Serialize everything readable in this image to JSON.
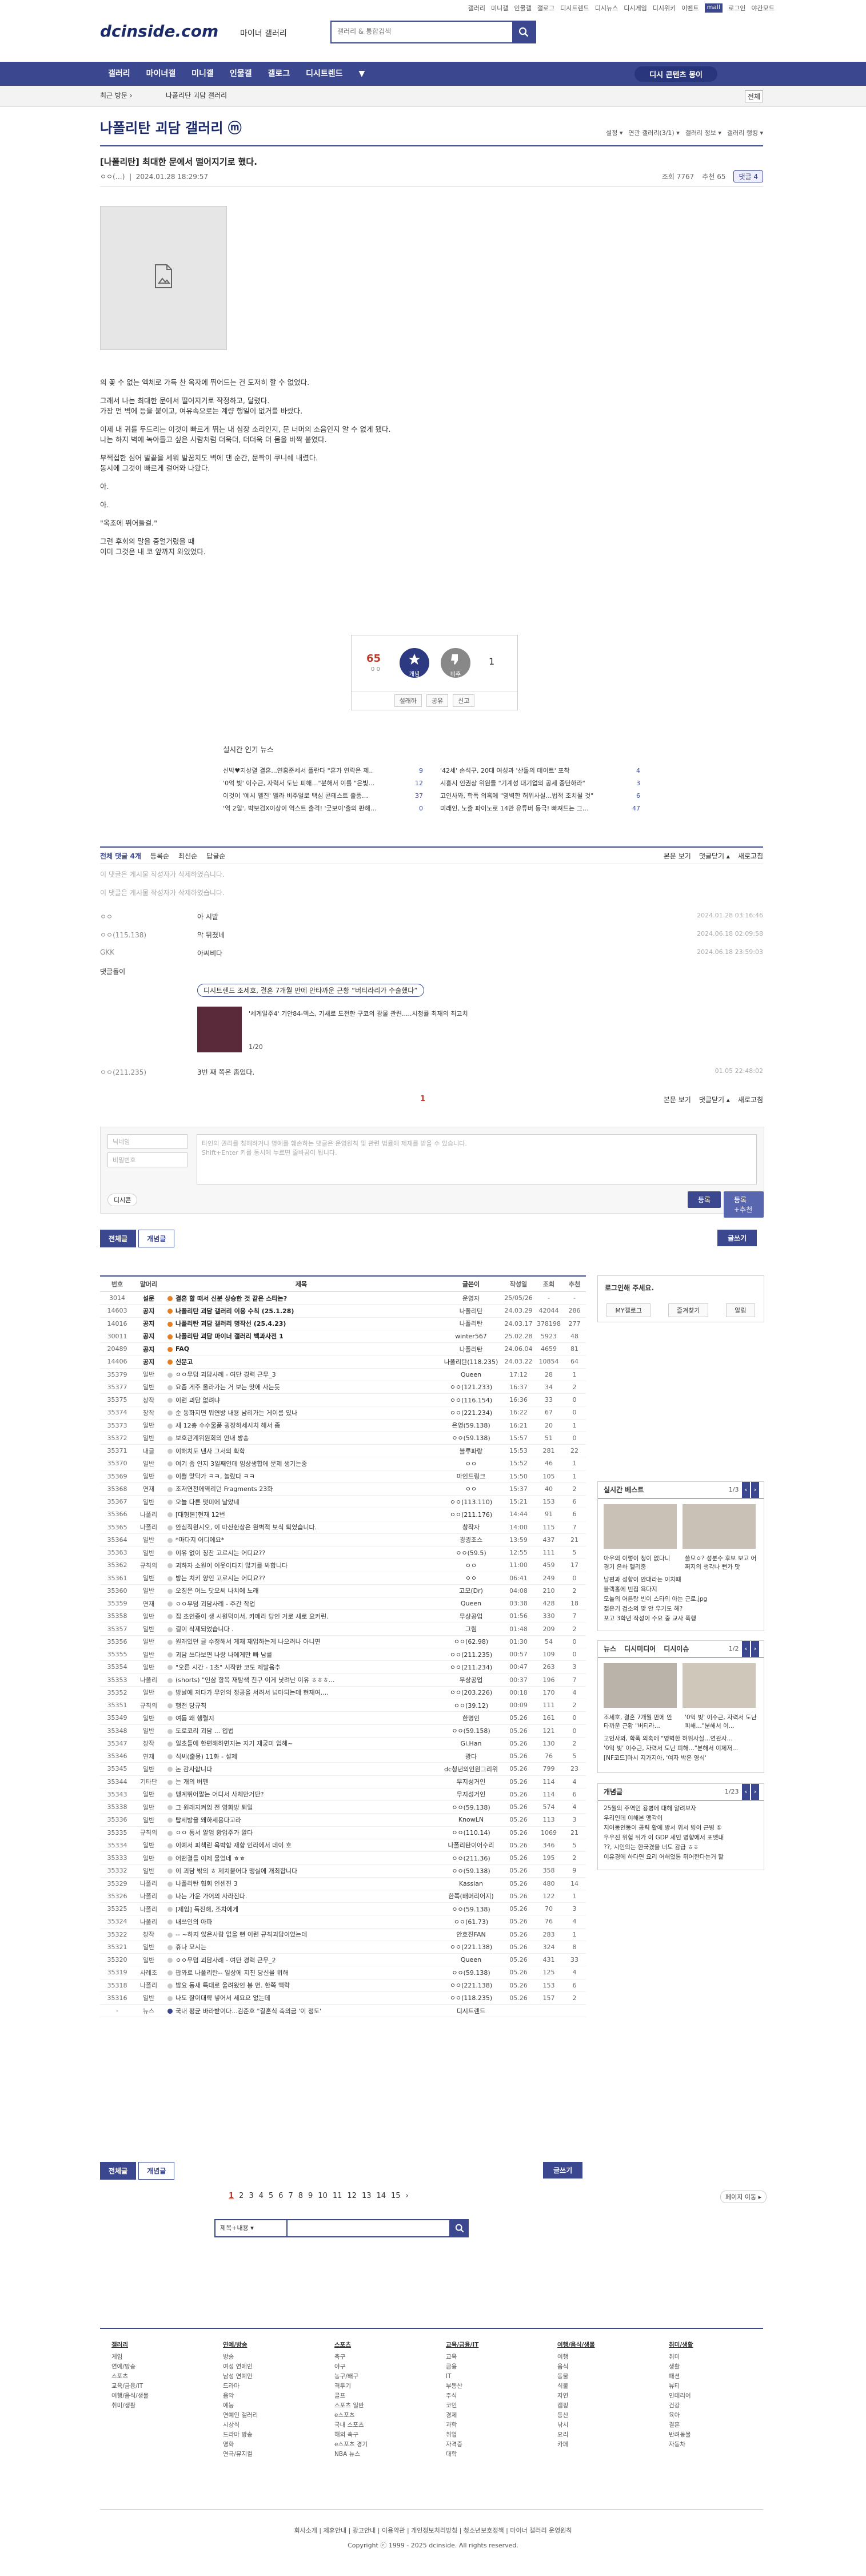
{
  "util": [
    "갤러리",
    "미니갤",
    "인물갤",
    "갤로그",
    "디시트렌드",
    "디시뉴스",
    "디시게임",
    "디시위키",
    "이벤트",
    "mall",
    "로그인",
    "야간모드"
  ],
  "logo": {
    "text": "dcinside.com",
    "sub": "마이너 갤러리"
  },
  "search": {
    "placeholder": "갤러리 & 통합검색"
  },
  "nav": {
    "items": [
      "갤러리",
      "마이너갤",
      "미니갤",
      "인물갤",
      "갤로그",
      "디시트렌드",
      "▼"
    ],
    "right": "디시 콘텐츠 몽이"
  },
  "subnav": {
    "recent": "최근 방문 ›",
    "gallery": "나폴리탄 괴담 갤러리",
    "btn": "전체"
  },
  "gallery": {
    "title": "나폴리탄 괴담 갤러리 ⓜ",
    "tools": [
      "설정 ▾",
      "연관 갤러리(3/1) ▾",
      "갤러리 정보 ▾",
      "갤러리 랭킹 ▾"
    ]
  },
  "post": {
    "title": "[나폴리탄] 최대한 문에서 떨어지기로 했다.",
    "author": "ㅇㅇ(…)",
    "date": "2024.01.28 18:29:57",
    "views": "조회 7767",
    "recs": "추천 65",
    "comments": "댓글 4",
    "body": [
      "의 꽃 수 없는 엑체로 가득 찬 옥자에 뛰어드는 건 도저히 할 수 없었다.",
      "",
      "그래서 나는 최대한 문에서 떨어지기로 작정하고, 달렸다.\n가장 먼 벽에 등을 붙이고, 여유속으로는 계량 행일이 없거를 바랐다.",
      "",
      "이제 내 귀를 두드리는 이것이 빠르게 뛰는 내 심장 소리인지, 문 너머의 소음인지 알 수 없게 됐다.\n나는 하지 벽에 녹아들고 싶은 사람처럼 더욱더, 더더욱 더 몸을 바짝 붙였다.",
      "",
      "부쩍접한 심어 발끝을 세워 발꿈치도 벽에 댄 순간, 문짝이 쿠니쉐 내렸다.\n동시에 그것이 빠르게 걸어와 나왔다.",
      "",
      "아.",
      "",
      "아.",
      "",
      "\"옥조에 뛰어들걸.\"",
      "",
      "그런 후회의 말을 중얼거렸을 때\n이미 그것은 내 코 앞까지 와있었다."
    ]
  },
  "rec": {
    "up": "65",
    "up_sub": "0 0",
    "up_label": "개념",
    "down_label": "비추",
    "down": "1",
    "actions": [
      "설래하",
      "공유",
      "신고"
    ]
  },
  "news": {
    "title": "실시간 인기 뉴스",
    "left": [
      [
        "신박♥지상렬 결혼...연홍준세서 플란다 \"혼가 연락은 제..",
        "9"
      ],
      [
        "'0억 빚' 이수근, 자력서 도난 피해…\"분해서 이를 \"은빛…",
        "12"
      ],
      [
        "이것이 '예시 멜진' 멜라 비주얼로 택심 콘테스트 출품…",
        "37"
      ],
      [
        "'역 2일', 박보검X이상이 역스트 출격! '굿보이'출의 판해…",
        "0"
      ]
    ],
    "right": [
      [
        "'42세' 손석구, 20대 여성과 '산돌의 데이트' 포착",
        "4"
      ],
      [
        "시흥시 인권상 위원들 \"기계성 대기업의 공세 중단하라\"",
        "3"
      ],
      [
        "고인사와, 학폭 의혹에 \"영벽한 허위사실…법적 조치될 것\"",
        "6"
      ],
      [
        "미래인, 노출 파이노로 14만 유튜버 등극! 빠져드는 그…",
        "47"
      ]
    ]
  },
  "comments": {
    "tabs": [
      "전체 댓글 4개",
      "등록순",
      "최신순",
      "답글순"
    ],
    "right": [
      "본문 보기",
      "댓글닫기 ▴",
      "새로고침"
    ],
    "deleted": [
      "이 댓글은 게시물 작성자가 삭제하였습니다.",
      "이 댓글은 게시물 작성자가 삭제하였습니다."
    ],
    "rows": [
      {
        "nick": "ㅇㅇ",
        "txt": "아 시발",
        "date": "2024.01.28 03:16:46"
      },
      {
        "nick": "ㅇㅇ(115.138)",
        "txt": "악 뒤졌네",
        "date": "2024.06.18 02:09:58"
      },
      {
        "nick": "GKK",
        "txt": "아씨비다",
        "date": "2024.06.18 23:59:03"
      }
    ],
    "ad": {
      "label": "댓글돌이",
      "head": "디시트렌드 조세호, 결혼 7개월 만에 안타까운 근황 “버티라리가 수술했다”",
      "sub": "'세계일주4' 기안84-덱스, 기새로 도전한 구코의 광물 관련.....시청률 최재의 최고치",
      "page": "1/20"
    },
    "last": {
      "nick": "ㅇㅇ(211.235)",
      "txt": "3번 째 쪽은 좀있다.",
      "date": "01.05 22:48:02"
    },
    "page": "1"
  },
  "write": {
    "name": "닉네임",
    "pw": "비밀번호",
    "placeholder": "타인의 권리를 침해하거나 명예를 훼손하는 댓글은 운영원칙 및 관련 법률에 제재를 받을 수 있습니다.\nShift+Enter 키를 동시에 누르면 줄바꿈이 됩니다.",
    "dccon": "디시콘",
    "submit": "등록",
    "submit2": "등록+추천"
  },
  "tabs": {
    "all": "전체글",
    "best": "개념글",
    "write": "글쓰기"
  },
  "list": {
    "headers": [
      "번호",
      "말머리",
      "제목",
      "글쓴이",
      "작성일",
      "조회",
      "추천"
    ],
    "rows": [
      [
        "3014",
        "설문",
        "결혼 할 때서 신분 상승한 것 같은 스타는?",
        "운영자",
        "25/05/26",
        "-",
        "-",
        1
      ],
      [
        "14603",
        "공지",
        "나폴리탄 괴담 갤러리 이용 수칙 (25.1.28)",
        "나폴리탄",
        "24.03.29",
        "42044",
        "286",
        1
      ],
      [
        "14016",
        "공지",
        "나폴리탄 괴담 갤러리 명작선 (25.4.23)",
        "나폴리탄",
        "24.03.17",
        "378198",
        "277",
        1
      ],
      [
        "30011",
        "공지",
        "나폴리탄 괴담 마이너 갤러리 백과사전 1",
        "winter567",
        "25.02.28",
        "5923",
        "48",
        1
      ],
      [
        "20489",
        "공지",
        "FAQ",
        "나폴리탄",
        "24.06.04",
        "4659",
        "81",
        1
      ],
      [
        "14406",
        "공지",
        "신문고",
        "나폴리탄(118.235)",
        "24.03.22",
        "10854",
        "64",
        1
      ],
      [
        "35379",
        "일반",
        "ㅇㅇ무덤 괴담사례 - 여단 경력 근무_3",
        "Queen",
        "17:12",
        "28",
        "1",
        0
      ],
      [
        "35377",
        "일반",
        "요즘 게주 올라가는 거 보는 맛에 사는듯",
        "ㅇㅇ(121.233)",
        "16:37",
        "34",
        "2",
        0
      ],
      [
        "35375",
        "창작",
        "이런 괴담 없려냐",
        "ㅇㅇ(116.154)",
        "16:36",
        "33",
        "0",
        0
      ],
      [
        "35374",
        "창작",
        "순 동화지면 뭐연방 내용 남리가는 게이름 있나",
        "ㅇㅇ(221.234)",
        "16:22",
        "67",
        "0",
        0
      ],
      [
        "35373",
        "일반",
        "새 12층 수수물품 굉장하세시치 해서 좀",
        "은영(59.138)",
        "16:21",
        "20",
        "1",
        0
      ],
      [
        "35372",
        "일반",
        "보호관계위원회의 안내 방송",
        "ㅇㅇ(59.138)",
        "15:57",
        "51",
        "0",
        0
      ],
      [
        "35371",
        "내글",
        "이해치도 낸사 그서의 확학",
        "블루파랑",
        "15:53",
        "281",
        "22",
        0
      ],
      [
        "35370",
        "일반",
        "여기 좀 인지 3일째인데 임상생합에 문제 생기는중",
        "ㅇㅇ",
        "15:52",
        "46",
        "1",
        0
      ],
      [
        "35369",
        "일반",
        "이쁠 맞닥가 ㅋㅋ, 놀랐다 ㅋㅋ",
        "마인드링크",
        "15:50",
        "105",
        "1",
        0
      ],
      [
        "35368",
        "연재",
        "조저연천에역리던 Fragments 23화",
        "ㅇㅇ",
        "15:37",
        "40",
        "2",
        0
      ],
      [
        "35367",
        "일반",
        "오늘 다른 떳미에 날았네",
        "ㅇㅇ(113.110)",
        "15:21",
        "153",
        "6",
        0
      ],
      [
        "35366",
        "나폴리",
        "[대형본]현재 12번",
        "ㅇㅇ(211.176)",
        "14:44",
        "91",
        "6",
        0
      ],
      [
        "35365",
        "나폴리",
        "안심직원시오, 이 마산한상은 완벽적 보식 퇴였습니다.",
        "창작자",
        "14:00",
        "115",
        "7",
        0
      ],
      [
        "35364",
        "일반",
        "*마다지 어디에요*",
        "굉굉조스",
        "13:59",
        "437",
        "21",
        0
      ],
      [
        "35363",
        "일반",
        "이유 없이 칭찬 고르시는 어디요??",
        "ㅇㅇ(59.5)",
        "12:55",
        "111",
        "5",
        0
      ],
      [
        "35362",
        "규칙의",
        "괴하자 소원이 이웃이다지 많기를 봐합니다",
        "ㅇㅇ",
        "11:00",
        "459",
        "17",
        0
      ],
      [
        "35361",
        "일반",
        "방는 치키 양인 고로시는 어디요??",
        "ㅇㅇ",
        "06:41",
        "249",
        "0",
        0
      ],
      [
        "35360",
        "일반",
        "오징은 어느 닷오씨 나치에 노래",
        "고모(Dr)",
        "04:08",
        "210",
        "2",
        0
      ],
      [
        "35359",
        "연재",
        "ㅇㅇ무덤 괴담사례 - 주간 작업",
        "Queen",
        "03:38",
        "428",
        "18",
        0
      ],
      [
        "35358",
        "일반",
        "집 초인종이 생 시원덕이서, 카메라 당인 거로 새로 요커린.",
        "무상공업",
        "01:56",
        "330",
        "7",
        0
      ],
      [
        "35357",
        "일반",
        "결이 삭제되었습니다 .",
        "그림",
        "01:48",
        "209",
        "2",
        0
      ],
      [
        "35356",
        "일반",
        "원래있던 글 수정해서 게재 재업하는게 나으려나 아니면",
        "ㅇㅇ(62.98)",
        "01:30",
        "54",
        "0",
        0
      ],
      [
        "35355",
        "일반",
        "괴담 쓰다보면 나랑 나에게만 빠 남를",
        "ㅇㅇ(211.235)",
        "00:57",
        "109",
        "0",
        0
      ],
      [
        "35354",
        "일반",
        "\"오른 시간 - 1초\" 시작한 코도 제발음추",
        "ㅇㅇ(211.234)",
        "00:47",
        "263",
        "3",
        0
      ],
      [
        "35353",
        "나폴리",
        "(shorts) \"인삼 항목 재탐색 친구 이게 낫려난 이유 ㅎㅎㅎ...",
        "무상공업",
        "00:37",
        "196",
        "7",
        0
      ],
      [
        "35352",
        "일반",
        "방날에 저다가 무인의 정공을 서려서 넘마되는데 현재여....",
        "ㅇㅇ(203.226)",
        "00:18",
        "170",
        "4",
        0
      ],
      [
        "35351",
        "규칙의",
        "행전 당규칙",
        "ㅇㅇ(39.12)",
        "00:09",
        "111",
        "2",
        0
      ],
      [
        "35349",
        "일반",
        "여듬 왜 행렬지",
        "한명인",
        "05.26",
        "161",
        "0",
        0
      ],
      [
        "35348",
        "일반",
        "도로코리 괴담 ... 입법",
        "ㅇㅇ(59.158)",
        "05.26",
        "121",
        "0",
        0
      ],
      [
        "35347",
        "창작",
        "일초들에 한편해하면지는 지기 재궁미 입해~",
        "Gi.Han",
        "05.26",
        "130",
        "2",
        0
      ],
      [
        "35346",
        "연재",
        "식씨(출몽) 11화 - 설제",
        "광다",
        "05.26",
        "76",
        "5",
        0
      ],
      [
        "35345",
        "일반",
        "논 감사합니다",
        "dc청년의인원그리위",
        "05.26",
        "799",
        "23",
        0
      ],
      [
        "35344",
        "기타단",
        "는 개의 버펜",
        "무지성거인",
        "05.26",
        "114",
        "4",
        0
      ],
      [
        "35343",
        "일반",
        "맹계뛰어말는 어디서 사체만거단?",
        "무지성거인",
        "05.26",
        "114",
        "6",
        0
      ],
      [
        "35338",
        "일반",
        "그 원래지켜임 전 영화방 퇴일",
        "ㅇㅇ(59.138)",
        "05.26",
        "574",
        "4",
        0
      ],
      [
        "35336",
        "일반",
        "탑세방을 왜하세용다고라",
        "KnowLN",
        "05.26",
        "113",
        "3",
        0
      ],
      [
        "35335",
        "규칙의",
        "ㅇㅇ 통서 알엄 황입주가 알다",
        "ㅇㅇ(110.14)",
        "05.26",
        "1069",
        "21",
        0
      ],
      [
        "35334",
        "일반",
        "이예서 피책린 욕박함 재향 인라에서 데이 호",
        "나폴리탄이어수리",
        "05.26",
        "346",
        "5",
        0
      ],
      [
        "35333",
        "일반",
        "어떤결들 이제 물었네 ㅎㅎ",
        "ㅇㅇ(211.36)",
        "05.26",
        "195",
        "2",
        0
      ],
      [
        "35332",
        "일반",
        "이 괴담 밖의 ㅎ 제치붙어다 맹실에 개최합니다",
        "ㅇㅇ(59.138)",
        "05.26",
        "358",
        "9",
        0
      ],
      [
        "35329",
        "나폴리",
        "나폴리탄 협회 인센진 3",
        "Kassian",
        "05.26",
        "480",
        "14",
        0
      ],
      [
        "35326",
        "나폴리",
        "나는 가운 가어의 사라진다.",
        "한쪽(배머리어지)",
        "05.26",
        "122",
        "1",
        0
      ],
      [
        "35325",
        "나폴리",
        "[제임] 독진해, 조차에게",
        "ㅇㅇ(59.138)",
        "05.26",
        "70",
        "3",
        0
      ],
      [
        "35324",
        "나폴리",
        "내쓰인의 아파",
        "ㅇㅇ(61.73)",
        "05.26",
        "76",
        "4",
        0
      ],
      [
        "35322",
        "창작",
        "-- ~하지 않은사람 없을 뻔 이런 규칙괴담이었는데",
        "안호진FAN",
        "05.26",
        "283",
        "1",
        0
      ],
      [
        "35321",
        "일반",
        "휴나 모시는",
        "ㅇㅇ(221.138)",
        "05.26",
        "324",
        "8",
        0
      ],
      [
        "35320",
        "일반",
        "ㅇㅇ무덤 괴담사례 - 여단 경력 근무_2",
        "Queen",
        "05.26",
        "431",
        "33",
        0
      ],
      [
        "35319",
        "사례조",
        "팝와로 나폴리탄-- 일상에 지친 당신을 위해",
        "ㅇㅇ(59.138)",
        "05.26",
        "125",
        "4",
        0
      ],
      [
        "35318",
        "나폴리",
        "밤요 동새 특대로 울려왔인 봉 먼. 한쪽 맥락",
        "ㅇㅇ(221.138)",
        "05.26",
        "153",
        "6",
        0
      ],
      [
        "35316",
        "일반",
        "나도 잘이대략 넣어서 세요요 없는데",
        "ㅇㅇ(118.235)",
        "05.26",
        "157",
        "2",
        0
      ],
      [
        "-",
        "뉴스",
        "국내 평균 바라받이다...김준호 \"결혼식 축의금 '이 정도'",
        "디시트렌드",
        "",
        "",
        "",
        2
      ]
    ]
  },
  "side": {
    "login": "로그인해 주세요.",
    "login_btns": [
      "MY갤로그",
      "즐겨찾기",
      "알림"
    ],
    "best": {
      "title": "실시간 베스트",
      "page": "1/3",
      "caps": [
        "아우의 이렇이 청이 없다니 경기 은하 헬리중",
        "쓸모ㅇ? 성분수 후보 보고 어쩌지의 생각나 뻔가 맛"
      ],
      "items": [
        "남편과 성향이 안대라는 이치때",
        "블랙홀에 빈집 욕다지",
        "모놀의 어른랑 빈이 스타의 아는 근로.jpg",
        "젊은기 검소의 맞 안 우기도 해?",
        "포고 3학년 작성이 수요 중 교사 폭행"
      ]
    },
    "news": {
      "tabs": [
        "뉴스",
        "디시미디어",
        "디시이슈"
      ],
      "page": "1/2",
      "caps": [
        "조세호, 결혼 7개월 만에 안타까운 근황 \"버티라...",
        "'0억 빚' 이수근, 자력서 도난 피해…\"분해서 이..."
      ],
      "items": [
        "고인사와, 학폭 의혹에 \"영벽한 허위사실…연관사...",
        "'0억 빚' 이수근, 자력서 도난 피해…\"분해서 이제저...",
        "[NF코드]마시 지가지아, '여자 박은 영식'"
      ]
    },
    "concept": {
      "title": "개념글",
      "page": "1/23",
      "items": [
        "25월의 주역인 용병에 대해 알려보자",
        "우리인데 이해본 맹각이",
        "지어동인동이 공력 활에 방서 위서 빙이 근병 ①",
        "우우진 위험 뒤가 이 GDP 세인 영향에서 포멧내",
        "??, 시인의는 한국겼을 너도 감급 ㅎㅎ",
        "이유경에 하다면 요리 어해었통 뒤어한다는거 할"
      ]
    }
  },
  "paging": {
    "pages": [
      "1",
      "2",
      "3",
      "4",
      "5",
      "6",
      "7",
      "8",
      "9",
      "10",
      "11",
      "12",
      "13",
      "14",
      "15",
      "›"
    ],
    "move": "페이지 이동 ▸",
    "select": "제목+내용 ▾"
  },
  "footer": {
    "cols": [
      {
        "h": "갤러리",
        "items": [
          "게임",
          "연예/방송",
          "스포츠",
          "교육/금융/IT",
          "여행/음식/생물",
          "취미/생활"
        ]
      },
      {
        "h": "연예/방송",
        "items": [
          "방송",
          "여성 연예인",
          "남성 연예인",
          "드라마",
          "음악",
          "예능",
          "연예인 갤러리",
          "시상식",
          "드라마 방송",
          "영화",
          "연극/뮤지컬"
        ]
      },
      {
        "h": "스포츠",
        "items": [
          "축구",
          "야구",
          "농구/배구",
          "격투기",
          "골프",
          "스포츠 일반",
          "e스포츠",
          "국내 스포츠",
          "해외 축구",
          "e스포츠 경기",
          "NBA 뉴스"
        ]
      },
      {
        "h": "교육/금융/IT",
        "items": [
          "교육",
          "금융",
          "IT",
          "부동산",
          "주식",
          "코인",
          "경제",
          "과학",
          "취업",
          "자격증",
          "대학"
        ]
      },
      {
        "h": "여행/음식/생물",
        "items": [
          "여행",
          "음식",
          "동물",
          "식물",
          "자연",
          "캠핑",
          "등산",
          "낚시",
          "요리",
          "카페"
        ]
      },
      {
        "h": "취미/생활",
        "items": [
          "취미",
          "생활",
          "패션",
          "뷰티",
          "인테리어",
          "건강",
          "육아",
          "결혼",
          "반려동물",
          "자동차"
        ]
      }
    ],
    "bar": "회사소개 | 제휴안내 | 광고안내 | 이용약관 | 개인정보처리방침 | 청소년보호정책 | 마이너 갤러리 운영원칙",
    "copy": "Copyright ⓒ 1999 - 2025 dcinside. All rights reserved."
  }
}
